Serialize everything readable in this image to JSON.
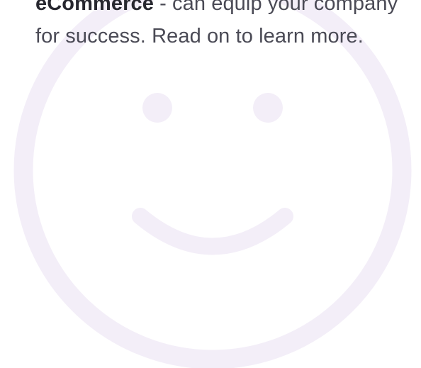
{
  "intro": {
    "line1_bold": "eCommerce",
    "line1_rest": " - can equip your company",
    "line2": "for success. Read on to learn more."
  },
  "illustration": {
    "icon": "smiley-face",
    "color": "#f3eef8"
  }
}
